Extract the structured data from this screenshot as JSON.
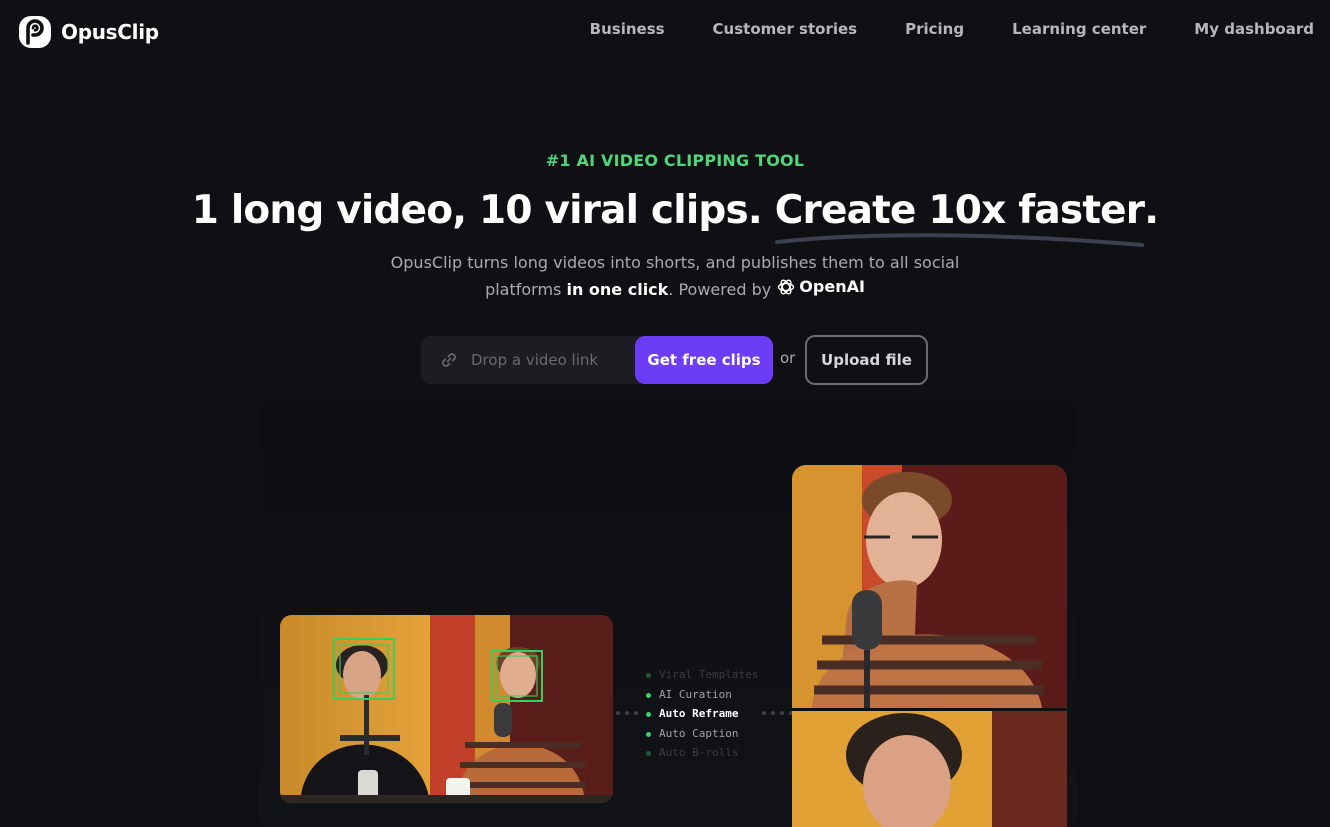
{
  "brand": {
    "name": "OpusClip"
  },
  "nav": {
    "items": [
      {
        "label": "Business"
      },
      {
        "label": "Customer stories"
      },
      {
        "label": "Pricing"
      },
      {
        "label": "Learning center"
      },
      {
        "label": "My dashboard"
      }
    ]
  },
  "hero": {
    "eyebrow": "#1 AI VIDEO CLIPPING TOOL",
    "headline_part1": "1 long video, 10 viral clips. ",
    "headline_part2": "Create 10x faster",
    "headline_part3": ".",
    "sub_part1": "OpusClip turns long videos into shorts, and publishes them to all social",
    "sub_part2": "platforms ",
    "sub_bold": "in one click",
    "sub_part3": ". Powered by ",
    "partner": "OpenAI"
  },
  "cta": {
    "input_placeholder": "Drop a video link",
    "primary_label": "Get free clips",
    "or_text": "or",
    "upload_label": "Upload file"
  },
  "features": [
    {
      "label": "Viral Templates"
    },
    {
      "label": "AI Curation"
    },
    {
      "label": "Auto Reframe"
    },
    {
      "label": "Auto Caption"
    },
    {
      "label": "Auto B-rolls"
    }
  ],
  "colors": {
    "background": "#101014",
    "accent": "#6c3df4",
    "eyebrow": "#4fd67a",
    "detect_box": "#33d15a"
  },
  "icons": [
    "opusclip-logo",
    "link-icon",
    "openai-logo"
  ]
}
